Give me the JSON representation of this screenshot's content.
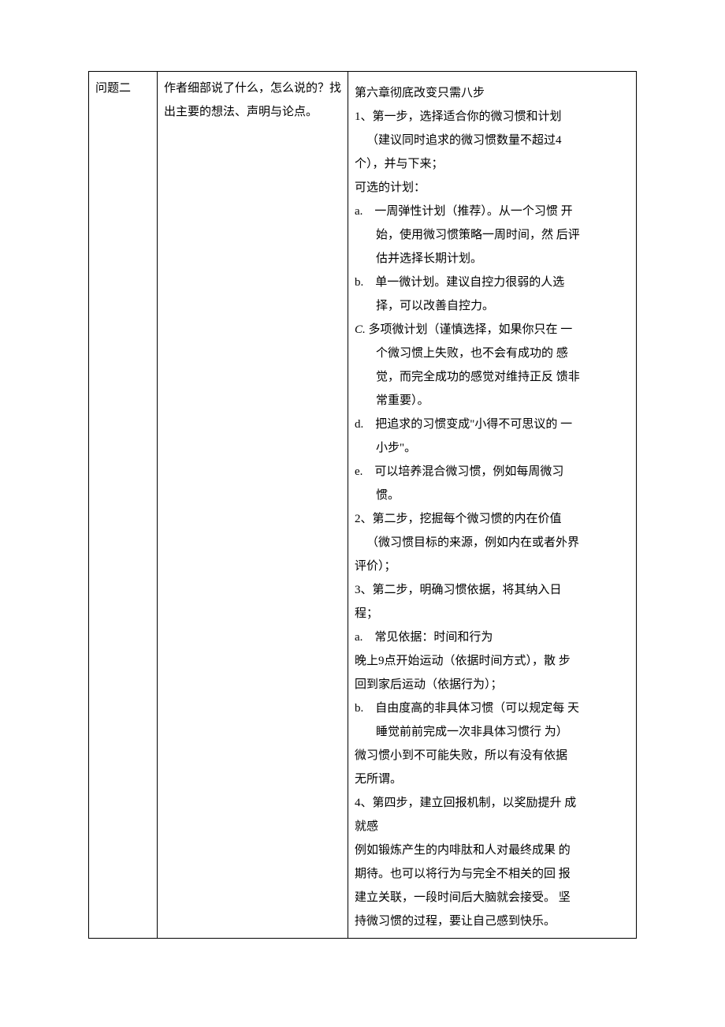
{
  "row_label": "问题二",
  "col2_text": "作者细部说了什么，怎么说的？找出主要的想法、声明与论点。",
  "col3": {
    "chapter_title": "第六章彻底改变只需八步",
    "step1_header": "1、第一步，选择适合你的微习惯和计划",
    "step1_line2": "（建议同时追求的微习惯数量不超过4",
    "step1_line3": "个），并与下来；",
    "plans_label": "可选的计划：",
    "plan_a_l1": "a.　一周弹性计划（推荐）。从一个习惯 开",
    "plan_a_l2": "始，使用微习惯策略一周时间，然 后评",
    "plan_a_l3": "估并选择长期计划。",
    "plan_b_l1": "b.　单一微计划。建议自控力很弱的人选",
    "plan_b_l2": "择，可以改善自控力。",
    "plan_c_prefix": "C.",
    "plan_c_l1_rest": " 多项微计划（谨慎选择，如果你只在 一",
    "plan_c_l2": "个微习惯上失败，也不会有成功的 感",
    "plan_c_l3": "觉，而完全成功的感觉对维持正反 馈非",
    "plan_c_l4": "常重要）。",
    "plan_d_l1": "d.　把追求的习惯变成\"小得不可思议的 一",
    "plan_d_l2": "小步\"。",
    "plan_e_l1": "e.　可以培养混合微习惯，例如每周微习",
    "plan_e_l2": "惯。",
    "step2_header": "2、第二步，挖掘每个微习惯的内在价值",
    "step2_l2": "（微习惯目标的来源，例如内在或者外界",
    "step2_l3": "评价）；",
    "step3_header": "3、第二步，明确习惯依据，将其纳入日",
    "step3_l2": "程；",
    "basis_a": "a.　常见依据：时间和行为",
    "basis_a_ex1": "晚上9点开始运动（依据时间方式），散 步",
    "basis_a_ex2": "回到家后运动（依据行为）；",
    "basis_b_l1": "b.　自由度高的非具体习惯（可以规定每 天",
    "basis_b_l2": "睡觉前前完成一次非具体习惯行 为）",
    "basis_note1": "微习惯小到不可能失败，所以有没有依据",
    "basis_note2": "无所谓。",
    "step4_header": "4、第四步，建立回报机制，以奖励提升 成",
    "step4_l2": "就感",
    "step4_ex1": "例如锻炼产生的内啡肽和人对最终成果 的",
    "step4_ex2": "期待。也可以将行为与完全不相关的回 报",
    "step4_ex3": "建立关联，一段时间后大脑就会接受。 坚",
    "step4_ex4": "持微习惯的过程，要让自己感到快乐。"
  }
}
